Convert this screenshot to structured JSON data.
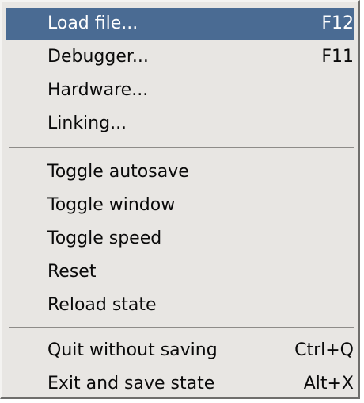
{
  "menu": {
    "items": [
      {
        "label": "Load file...",
        "accel": "F12"
      },
      {
        "label": "Debugger...",
        "accel": "F11"
      },
      {
        "label": "Hardware...",
        "accel": ""
      },
      {
        "label": "Linking...",
        "accel": ""
      },
      {
        "label": "Toggle autosave",
        "accel": ""
      },
      {
        "label": "Toggle window",
        "accel": ""
      },
      {
        "label": "Toggle speed",
        "accel": ""
      },
      {
        "label": "Reset",
        "accel": ""
      },
      {
        "label": "Reload state",
        "accel": ""
      },
      {
        "label": "Quit without saving",
        "accel": "Ctrl+Q"
      },
      {
        "label": "Exit and save state",
        "accel": "Alt+X"
      }
    ],
    "selected_index": 0
  },
  "colors": {
    "menu_background": "#e8e6e3",
    "highlight": "#4a6b93",
    "highlight_text": "#ffffff",
    "text": "#0a0a0a"
  }
}
